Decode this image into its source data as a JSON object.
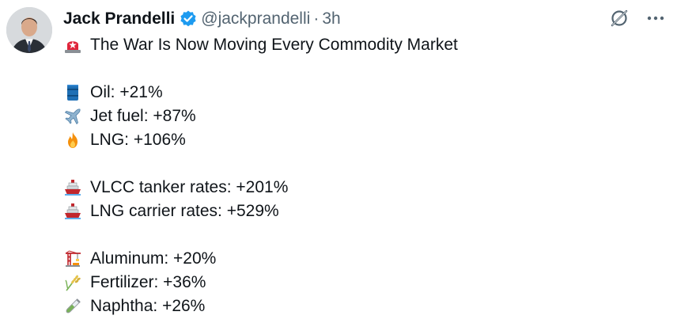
{
  "tweet": {
    "author": {
      "name": "Jack Prandelli",
      "handle": "@jackprandelli",
      "separator": "·",
      "time": "3h"
    },
    "headline": {
      "icon": "rotating-light-icon",
      "text": "The War Is Now Moving Every Commodity Market"
    },
    "groups": [
      {
        "items": [
          {
            "icon": "oil-barrel-icon",
            "text": "Oil: +21%"
          },
          {
            "icon": "airplane-icon",
            "text": "Jet fuel: +87%"
          },
          {
            "icon": "fire-icon",
            "text": "LNG: +106%"
          }
        ]
      },
      {
        "items": [
          {
            "icon": "ship-icon",
            "text": "VLCC tanker rates: +201%"
          },
          {
            "icon": "ship-icon",
            "text": "LNG carrier rates: +529%"
          }
        ]
      },
      {
        "items": [
          {
            "icon": "construction-crane-icon",
            "text": "Aluminum: +20%"
          },
          {
            "icon": "rice-stalk-icon",
            "text": "Fertilizer: +36%"
          },
          {
            "icon": "test-tube-icon",
            "text": "Naphtha: +26%"
          }
        ]
      }
    ]
  },
  "colors": {
    "text": "#0f1419",
    "secondary": "#536471",
    "verified": "#1d9bf0"
  }
}
